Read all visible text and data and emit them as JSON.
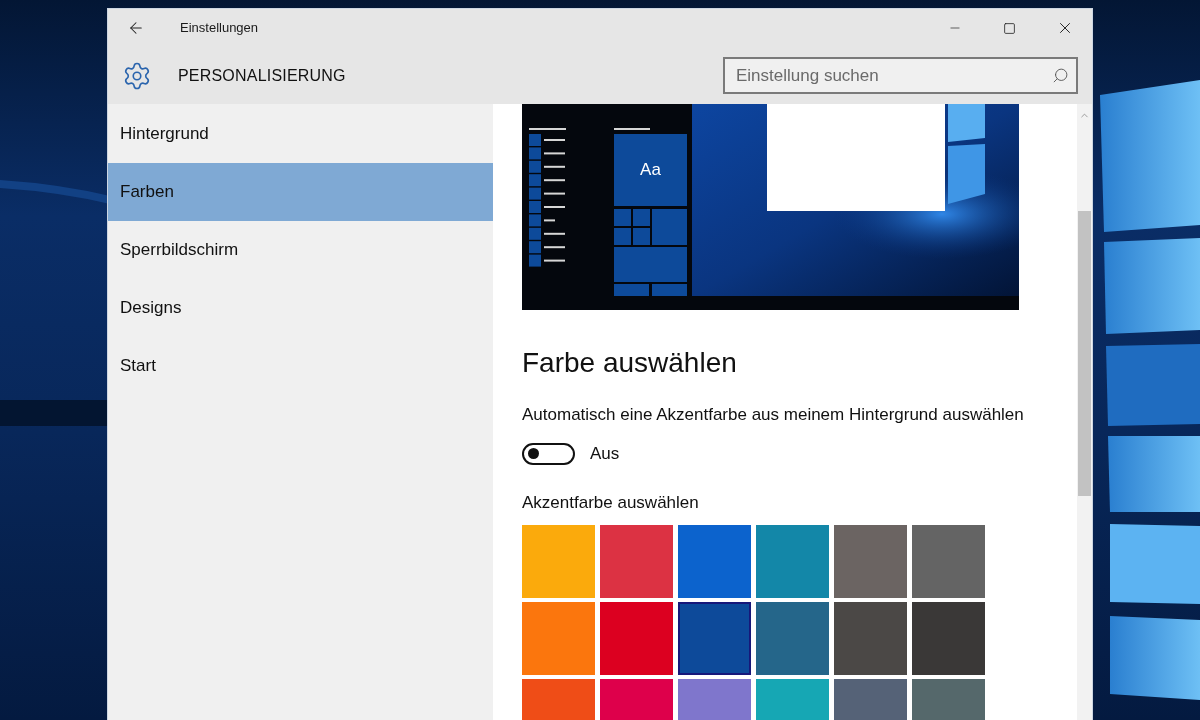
{
  "window": {
    "title": "Einstellungen"
  },
  "header": {
    "title": "PERSONALISIERUNG"
  },
  "search": {
    "placeholder": "Einstellung suchen"
  },
  "sidebar": {
    "items": [
      {
        "label": "Hintergrund",
        "selected": false
      },
      {
        "label": "Farben",
        "selected": true
      },
      {
        "label": "Sperrbildschirm",
        "selected": false
      },
      {
        "label": "Designs",
        "selected": false
      },
      {
        "label": "Start",
        "selected": false
      }
    ]
  },
  "preview": {
    "tile_label": "Aa"
  },
  "color_section": {
    "heading": "Farbe auswählen",
    "auto_accent": {
      "label": "Automatisch eine Akzentfarbe aus meinem Hintergrund auswählen",
      "on": false,
      "state_text": "Aus"
    },
    "palette_label": "Akzentfarbe auswählen",
    "swatches": [
      {
        "color": "#fbaa0c",
        "selected": false
      },
      {
        "color": "#dc3243",
        "selected": false
      },
      {
        "color": "#0c63cd",
        "selected": false
      },
      {
        "color": "#1387a8",
        "selected": false
      },
      {
        "color": "#6b6462",
        "selected": false
      },
      {
        "color": "#646464",
        "selected": false
      },
      {
        "color": "#fb760d",
        "selected": false
      },
      {
        "color": "#dc0020",
        "selected": false
      },
      {
        "color": "#0d4a9a",
        "selected": true
      },
      {
        "color": "#25668a",
        "selected": false
      },
      {
        "color": "#4b4846",
        "selected": false
      },
      {
        "color": "#3a3837",
        "selected": false
      },
      {
        "color": "#ef4d17",
        "selected": false
      },
      {
        "color": "#de004b",
        "selected": false
      },
      {
        "color": "#7f76cc",
        "selected": false
      },
      {
        "color": "#16a7b4",
        "selected": false
      },
      {
        "color": "#556277",
        "selected": false
      },
      {
        "color": "#55686b",
        "selected": false
      }
    ]
  }
}
